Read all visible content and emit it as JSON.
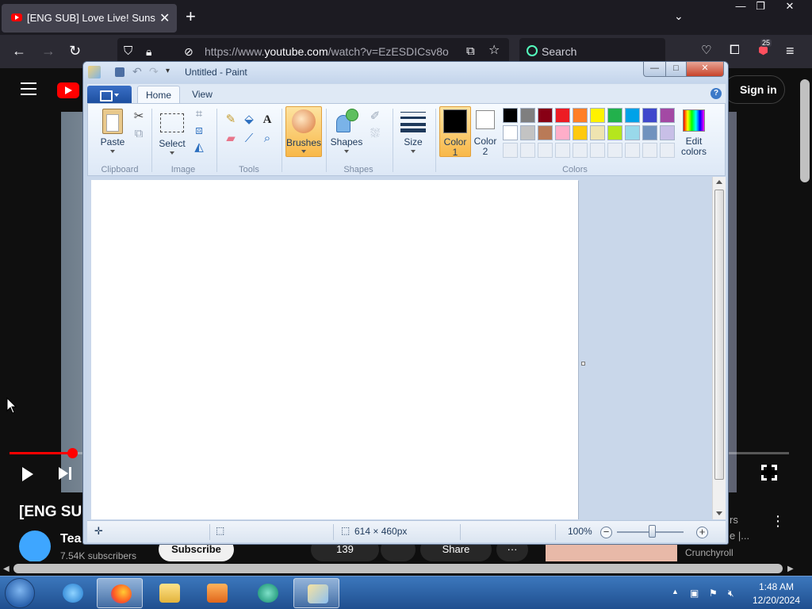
{
  "firefox": {
    "tab_title": "[ENG SUB] Love Live! Sunshine!!",
    "tab_close": "✕",
    "new_tab": "+",
    "list_tabs": "⌄",
    "window": {
      "minimize": "—",
      "maximize": "❐",
      "close": "✕"
    },
    "url_scheme": "https://www.",
    "url_host": "youtube.com",
    "url_path": "/watch?v=EzESDICsv8o",
    "search_placeholder": "Search",
    "extension_badge": "25"
  },
  "youtube": {
    "sign_in": "Sign in",
    "video_title": "[ENG SUB",
    "channel_name": "Tea",
    "subscribers": "7.54K subscribers",
    "subscribe": "Subscribe",
    "likes": "139",
    "share": "Share",
    "more": "···",
    "side_text_line1": "rs",
    "side_text_line2": "e |...",
    "side_channel": "Crunchyroll",
    "playback_progress": 0.08
  },
  "paint": {
    "title": "Untitled - Paint",
    "window": {
      "minimize": "—",
      "maximize": "□",
      "close": "✕"
    },
    "tabs": {
      "home": "Home",
      "view": "View"
    },
    "help": "?",
    "groups": {
      "clipboard": "Clipboard",
      "image": "Image",
      "tools": "Tools",
      "shapes": "Shapes",
      "colors": "Colors"
    },
    "buttons": {
      "paste": "Paste",
      "select": "Select",
      "brushes": "Brushes",
      "shapes": "Shapes",
      "size": "Size",
      "color1_line1": "Color",
      "color1_line2": "1",
      "color2_line1": "Color",
      "color2_line2": "2",
      "edit_colors_line1": "Edit",
      "edit_colors_line2": "colors"
    },
    "icons": {
      "cut": "cut-icon",
      "copy": "copy-icon",
      "crop": "crop-icon",
      "resize": "resize-icon",
      "rotate": "rotate-icon",
      "pencil": "pencil-icon",
      "fill": "fill-icon",
      "text": "text-icon",
      "eraser": "eraser-icon",
      "picker": "color-picker-icon",
      "magnifier": "magnifier-icon"
    },
    "text_tool_glyph": "A",
    "palette": {
      "row1": [
        "#000000",
        "#7f7f7f",
        "#880015",
        "#ed1c24",
        "#ff7f27",
        "#fff200",
        "#22b14c",
        "#00a2e8",
        "#3f48cc",
        "#a349a4"
      ],
      "row2": [
        "#ffffff",
        "#c3c3c3",
        "#b97a57",
        "#ffaec9",
        "#ffc90e",
        "#efe4b0",
        "#b5e61d",
        "#99d9ea",
        "#7092be",
        "#c8bfe7"
      ]
    },
    "color1": "#000000",
    "color2": "#ffffff",
    "status": {
      "canvas_size": "614 × 460px",
      "zoom": "100%",
      "zoom_out": "−",
      "zoom_in": "+"
    }
  },
  "taskbar": {
    "time": "1:48 AM",
    "date": "12/20/2024"
  }
}
